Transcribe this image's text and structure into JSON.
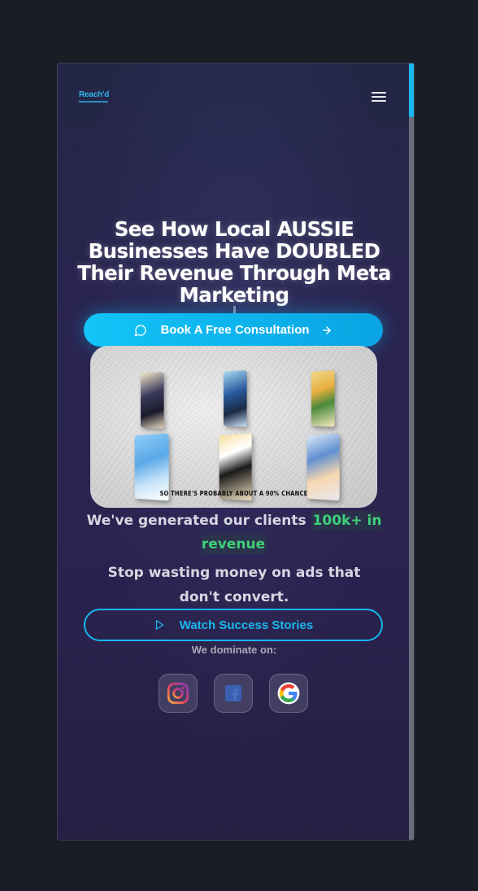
{
  "brand": {
    "logo_text": "Reach'd",
    "accent": "#12c4f8",
    "highlight": "#3fd07a"
  },
  "header": {
    "menu_icon": "hamburger-menu-icon"
  },
  "hero": {
    "headline": "See How Local AUSSIE Businesses Have DOUBLED Their Revenue Through Meta Marketing",
    "primary_cta": "Book A Free Consultation",
    "primary_cta_icons": [
      "chat-bubble-icon",
      "arrow-right-icon"
    ],
    "video_caption": "SO THERE'S PROBABLY ABOUT A 90% CHANCE",
    "stat_prefix": "We've generated our clients",
    "stat_value": "100k+ in revenue",
    "subline": "Stop wasting money on ads that don't convert.",
    "secondary_cta": "Watch Success Stories",
    "secondary_cta_icon": "play-icon"
  },
  "platforms": {
    "label": "We dominate on:",
    "items": [
      {
        "name": "Instagram",
        "icon": "instagram-icon"
      },
      {
        "name": "Facebook",
        "icon": "facebook-icon"
      },
      {
        "name": "Google",
        "icon": "google-icon"
      }
    ]
  }
}
